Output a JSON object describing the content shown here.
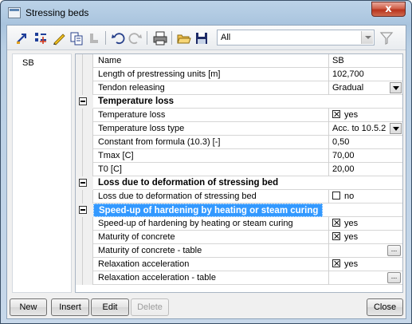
{
  "window": {
    "title": "Stressing beds",
    "close_glyph": "x"
  },
  "toolbar": {
    "icons": [
      "new-row-icon",
      "insert-icon",
      "edit-icon",
      "copy-icon",
      "delete-icon",
      "undo-icon",
      "redo-icon",
      "print-icon",
      "open-icon",
      "save-icon"
    ],
    "filter_value": "All",
    "filter_icon": "funnel-icon"
  },
  "left_list": {
    "items": [
      "SB"
    ]
  },
  "grid": {
    "rows": [
      {
        "type": "prop",
        "name": "Name",
        "value": "SB",
        "editor": "text"
      },
      {
        "type": "prop",
        "name": "Length of prestressing units [m]",
        "value": "102,700",
        "editor": "text"
      },
      {
        "type": "prop",
        "name": "Tendon releasing",
        "value": "Gradual",
        "editor": "dropdown"
      },
      {
        "type": "group",
        "name": "Temperature loss",
        "expanded": true
      },
      {
        "type": "prop",
        "name": "Temperature loss",
        "value": "yes",
        "editor": "checkbox",
        "checked": true
      },
      {
        "type": "prop",
        "name": "Temperature loss type",
        "value": "Acc. to 10.5.2",
        "editor": "dropdown"
      },
      {
        "type": "prop",
        "name": "Constant from formula (10.3) [-]",
        "value": "0,50",
        "editor": "text"
      },
      {
        "type": "prop",
        "name": "Tmax [C]",
        "value": "70,00",
        "editor": "text"
      },
      {
        "type": "prop",
        "name": "T0 [C]",
        "value": "20,00",
        "editor": "text"
      },
      {
        "type": "group",
        "name": "Loss due to deformation of stressing bed",
        "expanded": true
      },
      {
        "type": "prop",
        "name": "Loss due to deformation of stressing bed",
        "value": "no",
        "editor": "checkbox",
        "checked": false
      },
      {
        "type": "group",
        "name": "Speed-up of hardening by heating or steam curing",
        "expanded": true,
        "selected": true
      },
      {
        "type": "prop",
        "name": "Speed-up of hardening by heating or steam curing",
        "value": "yes",
        "editor": "checkbox",
        "checked": true
      },
      {
        "type": "prop",
        "name": "Maturity of concrete",
        "value": "yes",
        "editor": "checkbox",
        "checked": true
      },
      {
        "type": "prop",
        "name": "Maturity of concrete - table",
        "value": "",
        "editor": "ellipsis"
      },
      {
        "type": "prop",
        "name": "Relaxation acceleration",
        "value": "yes",
        "editor": "checkbox",
        "checked": true
      },
      {
        "type": "prop",
        "name": "Relaxation acceleration - table",
        "value": "",
        "editor": "ellipsis"
      }
    ],
    "ellipsis_label": "..."
  },
  "buttons": {
    "new": "New",
    "insert": "Insert",
    "edit": "Edit",
    "delete": "Delete",
    "close": "Close"
  }
}
